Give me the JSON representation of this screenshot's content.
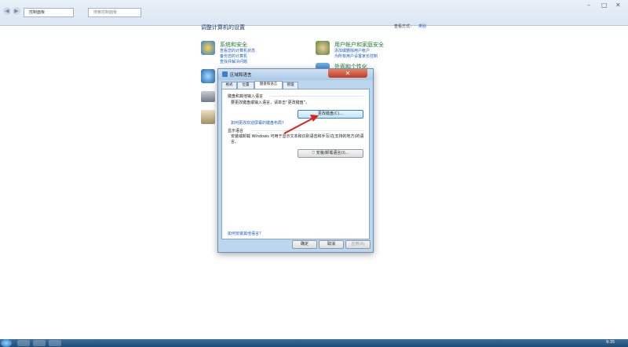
{
  "explorer": {
    "address": "控制面板",
    "search_placeholder": "搜索控制面板",
    "min": "–",
    "max": "□",
    "close": "✕"
  },
  "control_panel": {
    "title": "调整计算机的设置",
    "view_by_label": "查看方式：",
    "view_by_value": "类别",
    "categories": [
      {
        "title": "系统和安全",
        "links": [
          "查看您的计算机状态",
          "备份您的计算机",
          "查找并解决问题"
        ]
      },
      {
        "title": "用户帐户和家庭安全",
        "links": [
          "添加或删除用户帐户",
          "为所有用户设置家长控制"
        ]
      },
      {
        "title": "外观和个性化",
        "links": []
      }
    ]
  },
  "dialog": {
    "title": "区域和语言",
    "close": "✕",
    "tabs": [
      "格式",
      "位置",
      "键盘和语言",
      "管理"
    ],
    "active_tab": "键盘和语言",
    "keyboard_group_title": "键盘和其他输入语言",
    "keyboard_desc": "要更改键盘或输入语言，请单击“更改键盘”。",
    "change_keyboard_button": "更改键盘(C)...",
    "keyboard_link": "如何更改欢迎屏幕的键盘布局?",
    "display_group_title": "显示语言",
    "display_desc": "安装或卸载 Windows 可用于显示文本和识别语音和手写(在支持的地方)的语言。",
    "install_button": "安装/卸载语言(I)...",
    "bottom_link": "如何安装其他语言?",
    "ok_button": "确定",
    "cancel_button": "取消",
    "apply_button": "应用(A)"
  },
  "taskbar": {
    "clock": "9:35"
  },
  "colors": {
    "annotation_arrow": "#e0201c",
    "link": "#1a59c4",
    "category_title": "#1c7a2e"
  }
}
